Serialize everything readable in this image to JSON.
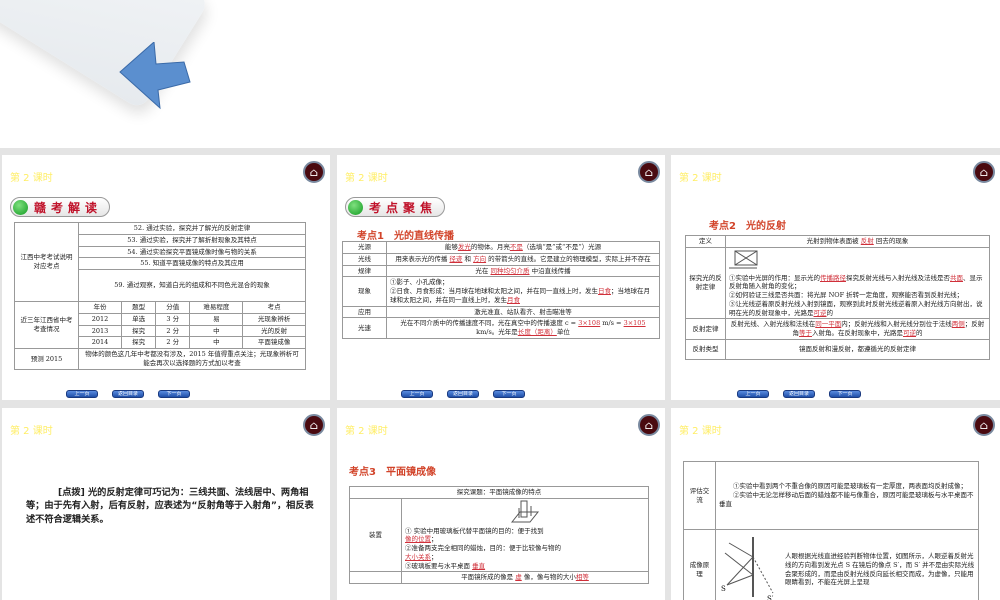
{
  "lesson_label": "第 2 课时",
  "nav_buttons": [
    "上一页",
    "返回目录",
    "下一页"
  ],
  "slide1": {
    "badge": "赣考解读",
    "row_head1": "江西中考考试说明对应考点",
    "points": [
      "52. 通过实验，探究并了解光的反射定律",
      "53. 通过实验，探究并了解折射现象及其特点",
      "54. 通过实验探究平面镜成像时像与物的关系",
      "55. 知道平面镜成像的特点及其应用",
      "59. 通过观察，知道白光的组成和不同色光混合的现象"
    ],
    "row_head2": "近三年江西省中考考查情况",
    "cols": [
      "年份",
      "题型",
      "分值",
      "难易程度",
      "考点"
    ],
    "rows": [
      [
        "2012",
        "单选",
        "3 分",
        "易",
        "光现象辨析"
      ],
      [
        "2013",
        "探究",
        "2 分",
        "中",
        "光的反射"
      ],
      [
        "2014",
        "探究",
        "2 分",
        "中",
        "平面镜成像"
      ]
    ],
    "forecast_head": "预测 2015",
    "forecast": "物体的颜色这几年中考都没有涉及，2015 年值得重点关注；光现象辨析可能会再次以选择题的方式加以考查"
  },
  "slide2": {
    "badge": "考点聚焦",
    "heading": "考点1　光的直线传播",
    "r1": {
      "h": "光源",
      "a": "能够",
      "b1": "发光",
      "c": "的物体。月亮",
      "b2": "不是",
      "d": "（选填“是”或“不是”）光源"
    },
    "r2": {
      "h": "光线",
      "a": "用来表示光的传播",
      "b1": "径迹",
      "c": "和",
      "b2": "方向",
      "d": "的带箭头的直线。它是建立的物理模型，实际上并不存在"
    },
    "r3": {
      "h": "规律",
      "a": "光在",
      "b1": "同种均匀介质",
      "d": "中沿直线传播"
    },
    "r4": {
      "h": "现象",
      "a": "①影子、小孔成像；",
      "b": "②日食、月食形成：当月球在地球和太阳之间，并在同一直线上时，发生",
      "b1": "日食",
      "c": "；当地球在月球和太阳之间，并在同一直线上时，发生",
      "b2": "月食"
    },
    "r5": {
      "h": "应用",
      "a": "激光准直、站队看齐、射击瞄准等"
    },
    "r6": {
      "h": "光速",
      "a": "光在不同介质中的传播速度不同，光在真空中的传播速度 c =",
      "b1": "3×108",
      "c": "m/s =",
      "b2": "3×105",
      "d": "km/s。光年是",
      "b3": "长度（距离）",
      "e": "单位"
    }
  },
  "slide3": {
    "heading": "考点2　光的反射",
    "r1": {
      "h": "定义",
      "a": "光射到物体表面被",
      "b1": "反射",
      "d": "回去的现象"
    },
    "r2": {
      "h": "探究光的反射定律",
      "a": "①实验中光屏的作用：显示光的",
      "b1": "传播路径",
      "c": "探究反射光线与入射光线及法线是否",
      "b2": "共面",
      "d": "、显示反射角随入射角的变化；",
      "e": "②如何验证三线是否共面：将光屏 NOF 折转一定角度，观察能否看到反射光线；",
      "f": "③让光线逆着原反射光线入射到镜面，观察到此时反射光线逆着原入射光线方向射出，说明在光的反射现象中，光路是",
      "b3": "可逆",
      "g": "的"
    },
    "r3": {
      "h": "反射定律",
      "a": "反射光线、入射光线和法线在",
      "b1": "同一平面",
      "c": "内；反射光线和入射光线分别位于法线",
      "b2": "两侧",
      "d": "；反射角",
      "b3": "等于",
      "e": "入射角。在反射现象中，光路是",
      "b4": "可逆",
      "f": "的"
    },
    "r4": {
      "h": "反射类型",
      "a": "镜面反射和漫反射，都遵循光的反射定律"
    }
  },
  "slide4": {
    "tip_label": "[点拨]",
    "tip": "光的反射定律可巧记为：三线共面、法线居中、两角相等；由于先有入射，后有反射，应表述为“反射角等于入射角”，相反表述不符合逻辑关系。"
  },
  "slide5": {
    "heading": "考点3　平面镜成像",
    "topic": "探究课题：平面镜成像的特点",
    "h": "装置",
    "a": "① 实验中用玻璃板代替平面镜的目的：便于找到",
    "b1": "像的位置",
    "b": "②准备两支完全相同的蜡烛，目的：便于比较像与物的",
    "b2": "大小关系",
    "c": "③玻璃板要与水平桌面",
    "b3": "垂直",
    "next": "平面镜所成的像是",
    "b4": "虚",
    "next2": "像，像与物的大小",
    "b5": "相等"
  },
  "slide6": {
    "h1": "评估交流",
    "a": "①实验中看到两个不重合像的原因可能是玻璃板有一定厚度，两表面均反射成像；",
    "b": "②实验中无论怎样移动后面的蜡烛都不能与像重合，原因可能是玻璃板与水平桌面不垂直",
    "h2": "成像原理",
    "c": "人眼根据光线直进经验判断物体位置，如图所示，人眼逆着反射光线的方向看到发光点 S 在镜后的像点 S′，而 S′ 并不是由实际光线会聚形成的，而是由反射光线反向延长相交而成，为虚像，只能用眼睛看到，不能在光屏上呈现",
    "s": "S",
    "s2": "S′"
  }
}
